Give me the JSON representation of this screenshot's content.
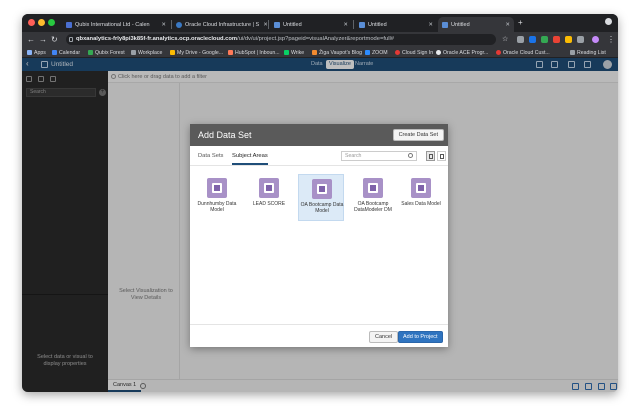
{
  "browser": {
    "tabs": [
      {
        "title": "Qubix International Ltd - Calen",
        "favicon_color": "#4a6fd1"
      },
      {
        "title": "Oracle Cloud Infrastructure | S",
        "favicon_color": "#3a79c4"
      },
      {
        "title": "Untitled",
        "favicon_color": "#5a8ed6"
      },
      {
        "title": "Untitled",
        "favicon_color": "#5a8ed6"
      },
      {
        "title": "Untitled",
        "favicon_color": "#5a8ed6"
      }
    ],
    "new_tab": "+",
    "url_host": "qbxanalytics-frly8pi3k85f-fr.analytics.ocp.oraclecloud.com",
    "url_path": "/ui/dv/ui/project.jsp?pageid=visualAnalyzer&reportmode=full#",
    "bookmarks": [
      {
        "label": "Apps",
        "color": "#8ab4f8"
      },
      {
        "label": "Calendar",
        "color": "#4285f4"
      },
      {
        "label": "Qubix Forest",
        "color": "#34a853"
      },
      {
        "label": "Workplace",
        "color": "#9aa0a6"
      },
      {
        "label": "My Drive - Google...",
        "color": "#fbbc04"
      },
      {
        "label": "HubSpot | Inboun...",
        "color": "#ff7a59"
      },
      {
        "label": "Wrike",
        "color": "#08cf65"
      },
      {
        "label": "Žiga Vaupot's Blog",
        "color": "#f28b30"
      },
      {
        "label": "ZOOM",
        "color": "#2d8cff"
      },
      {
        "label": "Cloud Sign In",
        "color": "#e53935"
      },
      {
        "label": "Oracle ACE Progr...",
        "color": "#e8eaed"
      },
      {
        "label": "Oracle Cloud Cust...",
        "color": "#e53935"
      }
    ],
    "reading_list": "Reading List"
  },
  "app": {
    "title": "Untitled",
    "nav": [
      "Data",
      "Visualize",
      "Narrate"
    ],
    "active_nav": "Visualize",
    "filter_hint": "Click here or drag data to add a filter",
    "search_placeholder": "Search",
    "viz_hint": "Select Visualization to View Details",
    "props_hint": "Select data or visual to display properties",
    "canvas_tab": "Canvas 1"
  },
  "modal": {
    "title": "Add Data Set",
    "create_button": "Create Data Set",
    "tabs": [
      "Data Sets",
      "Subject Areas"
    ],
    "active_tab": "Subject Areas",
    "search_placeholder": "Search",
    "items": [
      {
        "label": "Dunnhumby Data Model",
        "selected": false
      },
      {
        "label": "LEAD SCORE",
        "selected": false
      },
      {
        "label": "OA Bootcamp Data Model",
        "selected": true
      },
      {
        "label": "OA Bootcamp DataModeler DM",
        "selected": false
      },
      {
        "label": "Sales Data Model",
        "selected": false
      }
    ],
    "cancel_button": "Cancel",
    "add_button": "Add to Project"
  }
}
